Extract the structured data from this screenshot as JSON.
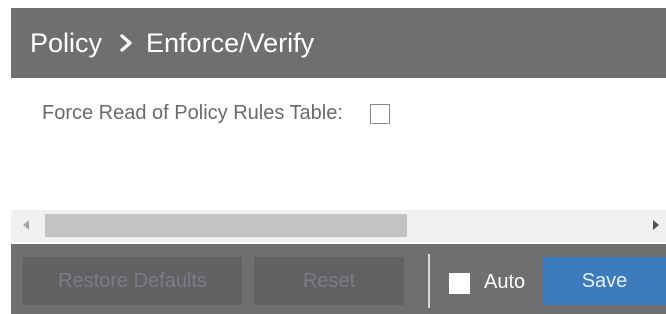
{
  "header": {
    "breadcrumb_root": "Policy",
    "breadcrumb_current": "Enforce/Verify"
  },
  "form": {
    "force_read_label": "Force Read of Policy Rules Table:",
    "force_read_checked": false
  },
  "footer": {
    "restore_defaults_label": "Restore Defaults",
    "reset_label": "Reset",
    "auto_label": "Auto",
    "auto_checked": false,
    "save_label": "Save"
  },
  "colors": {
    "header_bg": "#6f6f71",
    "save_bg": "#3c7bbc",
    "disabled_button_bg": "#616164"
  },
  "icons": {
    "breadcrumb_separator": "chevron-right-icon",
    "scroll_left": "arrow-left-icon",
    "scroll_right": "arrow-right-icon"
  }
}
